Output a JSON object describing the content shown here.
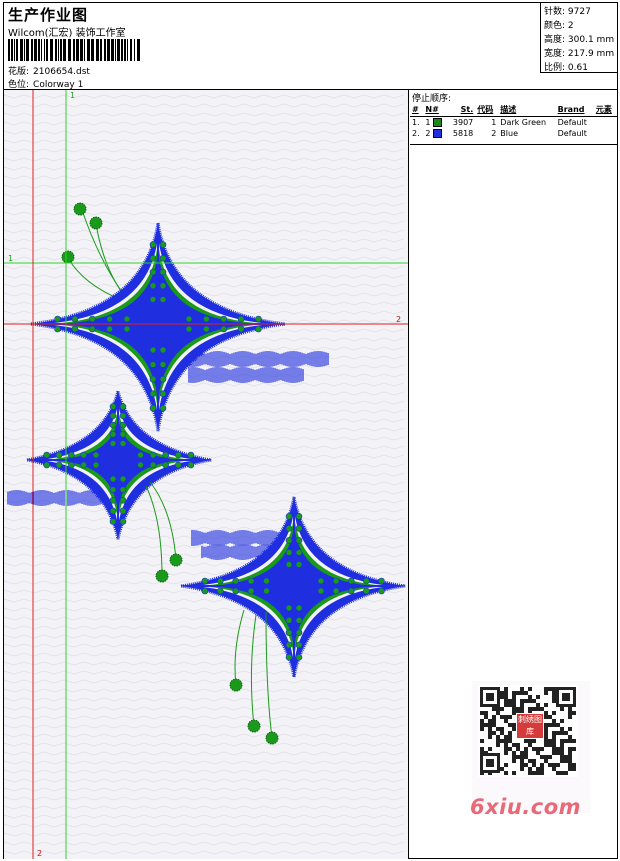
{
  "header": {
    "title": "生产作业图",
    "company": "Wilcom(汇宏) 装饰工作室",
    "design_label": "花版:",
    "design_value": "2106654.dst",
    "colorway_label": "色位:",
    "colorway_value": "Colorway 1"
  },
  "stats": [
    {
      "label": "针数:",
      "value": "9727"
    },
    {
      "label": "颜色:",
      "value": "2"
    },
    {
      "label": "高度:",
      "value": "300.1 mm"
    },
    {
      "label": "宽度:",
      "value": "217.9 mm"
    },
    {
      "label": "比例:",
      "value": "0.61"
    }
  ],
  "canvas": {
    "guide_v1": "1",
    "guide_h1": "1",
    "guide_h2": "2",
    "guide_v2": "2"
  },
  "stop_sequence": {
    "heading": "停止顺序:",
    "columns": [
      "#",
      "N#",
      "St.",
      "代码",
      "描述",
      "Brand",
      "元素"
    ],
    "rows": [
      {
        "num": "1.",
        "n": "1",
        "st": "3907",
        "code": "1",
        "desc": "Dark Green",
        "brand": "Default",
        "color": "#1a8a1a"
      },
      {
        "num": "2.",
        "n": "2",
        "st": "5818",
        "code": "2",
        "desc": "Blue",
        "brand": "Default",
        "color": "#1f2fe0"
      }
    ]
  },
  "watermark": {
    "site": "6xiu.com",
    "stamp": "刺绣图库"
  },
  "colors": {
    "blue": "#1f2fe0",
    "green": "#1a9a1a",
    "guide_green": "#2fd12f",
    "guide_red": "#e02020"
  }
}
